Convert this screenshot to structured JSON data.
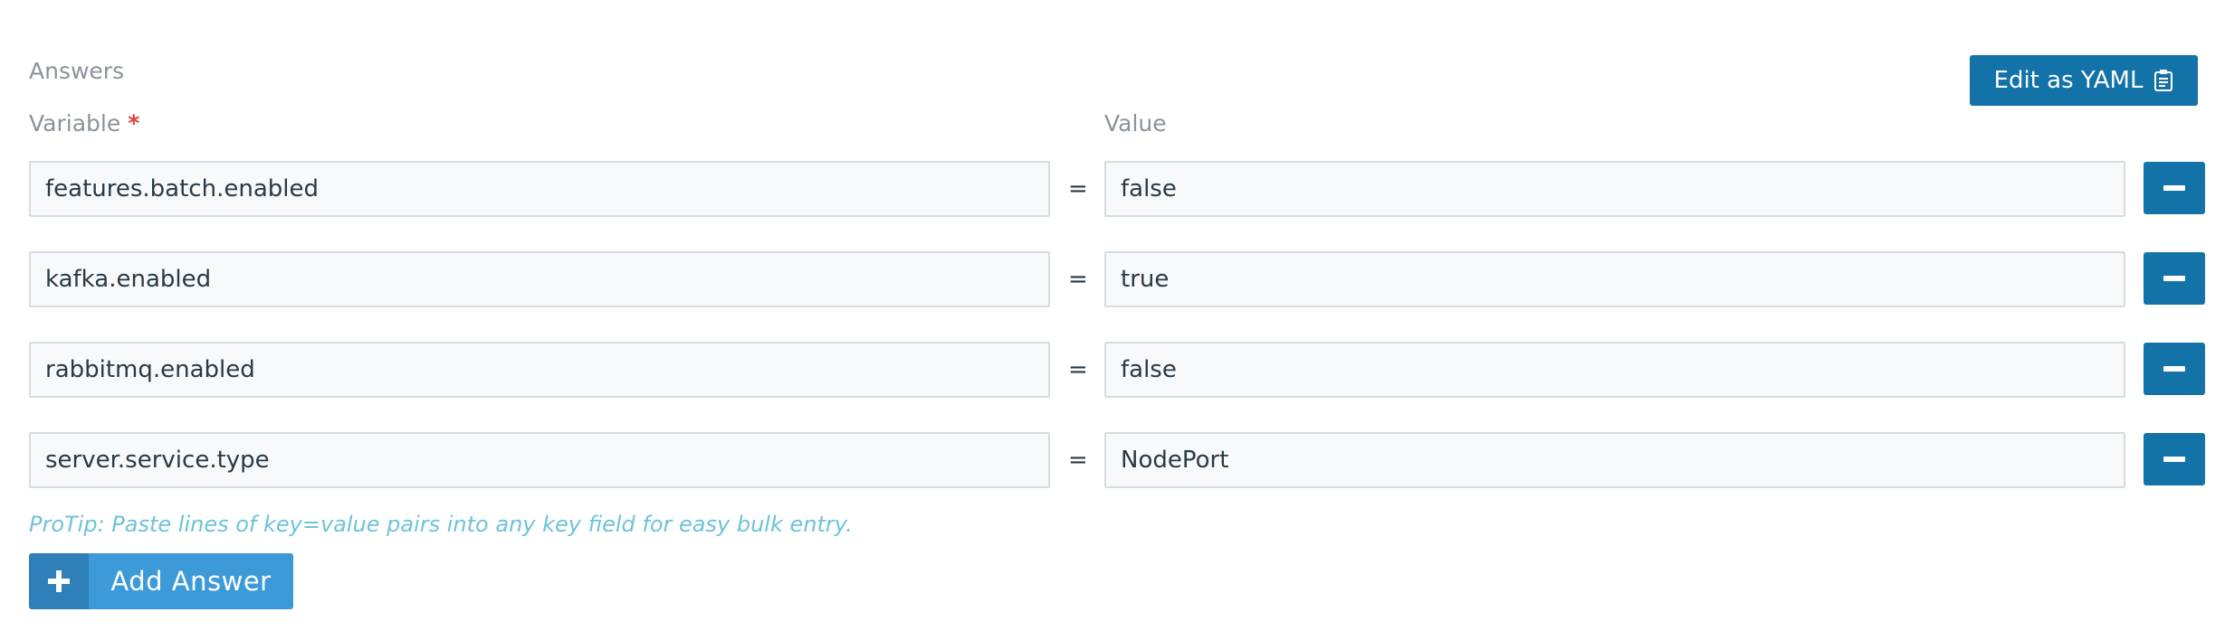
{
  "section": {
    "title": "Answers"
  },
  "toolbar": {
    "edit_yaml_label": "Edit as YAML",
    "edit_yaml_icon": "clipboard-icon"
  },
  "columns": {
    "variable": "Variable",
    "required_marker": "*",
    "value": "Value"
  },
  "answers": [
    {
      "key": "features.batch.enabled",
      "equals": "=",
      "value": "false"
    },
    {
      "key": "kafka.enabled",
      "equals": "=",
      "value": "true"
    },
    {
      "key": "rabbitmq.enabled",
      "equals": "=",
      "value": "false"
    },
    {
      "key": "server.service.type",
      "equals": "=",
      "value": "NodePort"
    }
  ],
  "protip": "ProTip: Paste lines of key=value pairs into any key field for easy bulk entry.",
  "add_answer": {
    "label": "Add Answer",
    "icon": "plus-icon"
  },
  "colors": {
    "primary_button": "#1372a8",
    "add_button": "#3d9ad8",
    "add_button_icon_bg": "#2f7fb8",
    "required": "#e03b3b",
    "protip": "#6ec3d8",
    "muted_label": "#8a939c",
    "input_border": "#d6dde2",
    "input_bg": "#f8f9fa"
  }
}
